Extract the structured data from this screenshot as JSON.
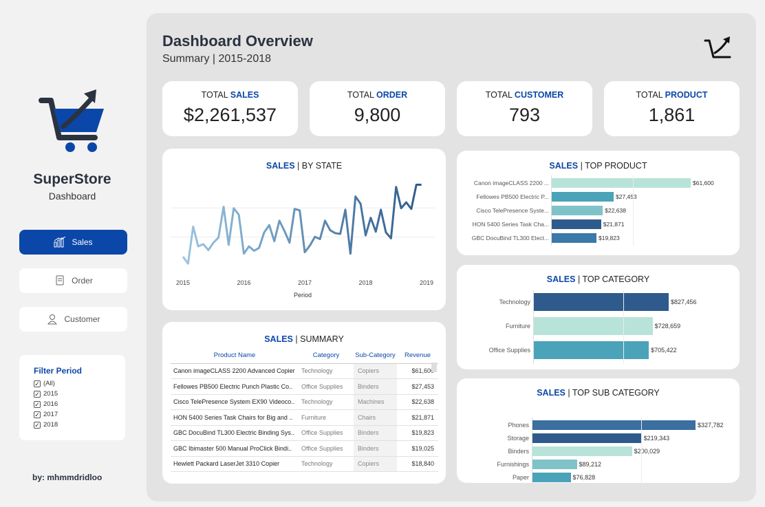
{
  "sidebar": {
    "brand": "SuperStore",
    "brand_sub": "Dashboard",
    "nav": [
      {
        "label": "Sales",
        "icon": "bar-chart-icon",
        "active": true
      },
      {
        "label": "Order",
        "icon": "receipt-icon",
        "active": false
      },
      {
        "label": "Customer",
        "icon": "user-icon",
        "active": false
      }
    ],
    "filter": {
      "title": "Filter Period",
      "options": [
        "(All)",
        "2015",
        "2016",
        "2017",
        "2018"
      ]
    },
    "author": "by: mhmmdridloo"
  },
  "header": {
    "title": "Dashboard Overview",
    "subtitle": "Summary | 2015-2018"
  },
  "kpis": [
    {
      "prefix": "TOTAL",
      "keyword": "SALES",
      "value": "$2,261,537"
    },
    {
      "prefix": "TOTAL",
      "keyword": "ORDER",
      "value": "9,800"
    },
    {
      "prefix": "TOTAL",
      "keyword": "CUSTOMER",
      "value": "793"
    },
    {
      "prefix": "TOTAL",
      "keyword": "PRODUCT",
      "value": "1,861"
    }
  ],
  "colors": {
    "primary": "#0b47a8",
    "dark_blue": "#2e5b8c",
    "teal": "#4aa3b8",
    "light_teal": "#b8e3d8"
  },
  "charts": {
    "by_state_title": {
      "keyword": "SALES",
      "rest": "| BY STATE"
    },
    "top_product_title": {
      "keyword": "SALES",
      "rest": "| TOP PRODUCT"
    },
    "top_category_title": {
      "keyword": "SALES",
      "rest": "| TOP CATEGORY"
    },
    "top_subcategory_title": {
      "keyword": "SALES",
      "rest": "| TOP SUB CATEGORY"
    },
    "summary_title": {
      "keyword": "SALES",
      "rest": "| SUMMARY"
    }
  },
  "chart_data": [
    {
      "id": "sales-by-state",
      "type": "line",
      "xlabel": "Period",
      "x_ticks": [
        "2015",
        "2016",
        "2017",
        "2018",
        "2019"
      ],
      "x_range": [
        2015,
        2019
      ],
      "y_range": [
        0,
        120000
      ],
      "grid": true,
      "x": [
        2015.0,
        2015.083,
        2015.167,
        2015.25,
        2015.333,
        2015.417,
        2015.5,
        2015.583,
        2015.667,
        2015.75,
        2015.833,
        2015.917,
        2016.0,
        2016.083,
        2016.167,
        2016.25,
        2016.333,
        2016.417,
        2016.5,
        2016.583,
        2016.667,
        2016.75,
        2016.833,
        2016.917,
        2017.0,
        2017.083,
        2017.167,
        2017.25,
        2017.333,
        2017.417,
        2017.5,
        2017.583,
        2017.667,
        2017.75,
        2017.833,
        2017.917,
        2018.0,
        2018.083,
        2018.167,
        2018.25,
        2018.333,
        2018.417,
        2018.5,
        2018.583,
        2018.667,
        2018.75,
        2018.833,
        2018.917
      ],
      "values": [
        14000,
        4500,
        55000,
        28000,
        31000,
        23000,
        33000,
        40000,
        82000,
        30000,
        80000,
        71000,
        18000,
        28000,
        22000,
        26000,
        47000,
        57000,
        35000,
        63000,
        49000,
        33000,
        79000,
        77000,
        20000,
        29000,
        41000,
        38000,
        63000,
        50000,
        46000,
        45000,
        78000,
        18000,
        96000,
        86000,
        43000,
        67000,
        48000,
        78000,
        47000,
        39000,
        109000,
        80000,
        88000,
        79000,
        112000,
        112000
      ]
    },
    {
      "id": "top-product",
      "type": "bar",
      "orientation": "horizontal",
      "categories": [
        "Canon imageCLASS 2200 ...",
        "Fellowes PB500 Electric P...",
        "Cisco TelePresence Syste...",
        "HON 5400 Series Task Cha...",
        "GBC DocuBind TL300 Elect..."
      ],
      "values": [
        61600,
        27453,
        22638,
        21871,
        19823
      ],
      "labels": [
        "$61,600",
        "$27,453",
        "$22,638",
        "$21,871",
        "$19,823"
      ],
      "colors": [
        "#b8e3d8",
        "#4aa3b8",
        "#7fc3c9",
        "#2e5b8c",
        "#3a79a8"
      ]
    },
    {
      "id": "top-category",
      "type": "bar",
      "orientation": "horizontal",
      "categories": [
        "Technology",
        "Furniture",
        "Office Supplies"
      ],
      "values": [
        827456,
        728659,
        705422
      ],
      "labels": [
        "$827,456",
        "$728,659",
        "$705,422"
      ],
      "colors": [
        "#2e5b8c",
        "#b8e3d8",
        "#4aa3b8"
      ]
    },
    {
      "id": "top-subcategory",
      "type": "bar",
      "orientation": "horizontal",
      "categories": [
        "Phones",
        "Storage",
        "Binders",
        "Furnishings",
        "Paper"
      ],
      "values": [
        327782,
        219343,
        200029,
        89212,
        76828
      ],
      "labels": [
        "$327,782",
        "$219,343",
        "$200,029",
        "$89,212",
        "$76,828"
      ],
      "colors": [
        "#3a6fa0",
        "#2e5b8c",
        "#b8e3d8",
        "#7fc3c9",
        "#4aa3b8"
      ]
    },
    {
      "id": "sales-summary",
      "type": "table",
      "columns": [
        "Product Name",
        "Category",
        "Sub-Category",
        "Revenue"
      ],
      "rows": [
        [
          "Canon imageCLASS 2200 Advanced Copier",
          "Technology",
          "Copiers",
          "$61,600"
        ],
        [
          "Fellowes PB500 Electric Punch Plastic Co..",
          "Office Supplies",
          "Binders",
          "$27,453"
        ],
        [
          "Cisco TelePresence System EX90 Videoco..",
          "Technology",
          "Machines",
          "$22,638"
        ],
        [
          "HON 5400 Series Task Chairs for Big and ..",
          "Furniture",
          "Chairs",
          "$21,871"
        ],
        [
          "GBC DocuBind TL300 Electric Binding Sys..",
          "Office Supplies",
          "Binders",
          "$19,823"
        ],
        [
          "GBC Ibimaster 500 Manual ProClick Bindi..",
          "Office Supplies",
          "Binders",
          "$19,025"
        ],
        [
          "Hewlett Packard LaserJet 3310 Copier",
          "Technology",
          "Copiers",
          "$18,840"
        ]
      ]
    }
  ]
}
